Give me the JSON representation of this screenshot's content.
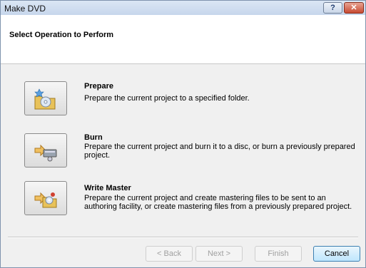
{
  "window": {
    "title": "Make DVD",
    "help_glyph": "?",
    "close_glyph": "✕"
  },
  "header": {
    "title": "Select Operation to Perform"
  },
  "operations": [
    {
      "title": "Prepare",
      "description": "Prepare the current project to a specified folder.",
      "icon": "folder-disc-icon"
    },
    {
      "title": "Burn",
      "description": "Prepare the current project and burn it to a disc, or burn a previously prepared project.",
      "icon": "disc-burner-icon"
    },
    {
      "title": "Write Master",
      "description": "Prepare the current project and create mastering files to be sent to an authoring facility, or create mastering files from a previously prepared project.",
      "icon": "master-files-icon"
    }
  ],
  "footer": {
    "back_label": "< Back",
    "next_label": "Next >",
    "finish_label": "Finish",
    "cancel_label": "Cancel"
  }
}
